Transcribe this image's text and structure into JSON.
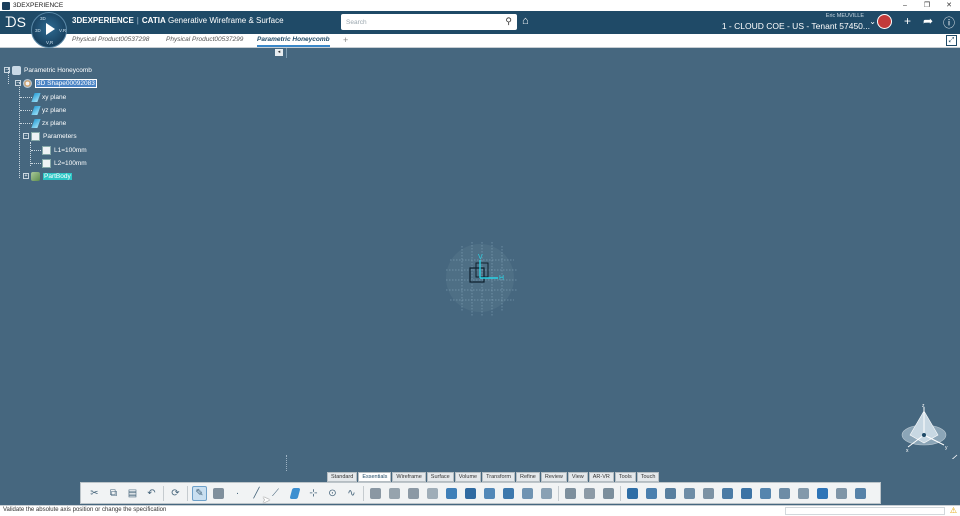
{
  "os_window": {
    "title": "3DEXPERIENCE",
    "controls": [
      "–",
      "❐",
      "✕"
    ]
  },
  "header": {
    "brand_prefix": "3DEXPERIENCE",
    "brand_app": "CATIA",
    "brand_module": "Generative Wireframe & Surface",
    "search_placeholder": "Search",
    "user_name": "Eric MEUVILLE",
    "tenant": "1 - CLOUD COE - US - Tenant 57450...",
    "compass_labels": {
      "top": "3D",
      "left": "3D",
      "right": "V.R",
      "bottom": "V,R"
    }
  },
  "tabs": [
    {
      "label": "Physical Product00537298",
      "active": false
    },
    {
      "label": "Physical Product00537299",
      "active": false
    },
    {
      "label": "Parametric Honeycomb",
      "active": true
    }
  ],
  "tree": {
    "root": "Parametric Honeycomb",
    "shape": "3D Shape00092083",
    "planes": [
      "xy plane",
      "yz plane",
      "zx plane"
    ],
    "parameters_label": "Parameters",
    "parameters": [
      "L1=100mm",
      "L2=100mm"
    ],
    "partbody": "PartBody"
  },
  "viewport": {
    "axis_labels": {
      "v": "V",
      "h": "H"
    },
    "compass_labels": {
      "z": "z",
      "x": "x",
      "y": "y"
    }
  },
  "command_tabs": [
    {
      "label": "Standard",
      "active": false
    },
    {
      "label": "Essentials",
      "active": true
    },
    {
      "label": "Wireframe",
      "active": false
    },
    {
      "label": "Surface",
      "active": false
    },
    {
      "label": "Volume",
      "active": false
    },
    {
      "label": "Transform",
      "active": false
    },
    {
      "label": "Refine",
      "active": false
    },
    {
      "label": "Review",
      "active": false
    },
    {
      "label": "View",
      "active": false
    },
    {
      "label": "AR-VR",
      "active": false
    },
    {
      "label": "Tools",
      "active": false
    },
    {
      "label": "Touch",
      "active": false
    }
  ],
  "status": {
    "message": "Validate the absolute axis position or change the specification"
  },
  "colors": {
    "viewport_bg": "#46677f",
    "header_bg": "#1f4a67",
    "selection": "#4a83c4",
    "highlight": "#2bc6c6",
    "axis": "#29d3e6"
  }
}
